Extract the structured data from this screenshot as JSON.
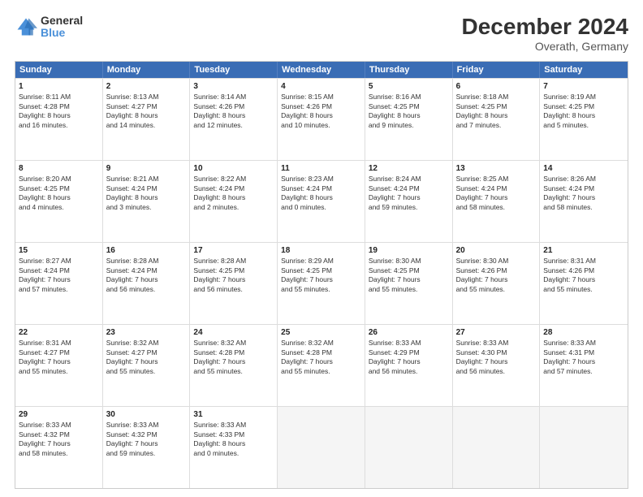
{
  "logo": {
    "line1": "General",
    "line2": "Blue"
  },
  "title": "December 2024",
  "subtitle": "Overath, Germany",
  "header_days": [
    "Sunday",
    "Monday",
    "Tuesday",
    "Wednesday",
    "Thursday",
    "Friday",
    "Saturday"
  ],
  "rows": [
    [
      {
        "day": "1",
        "lines": [
          "Sunrise: 8:11 AM",
          "Sunset: 4:28 PM",
          "Daylight: 8 hours",
          "and 16 minutes."
        ]
      },
      {
        "day": "2",
        "lines": [
          "Sunrise: 8:13 AM",
          "Sunset: 4:27 PM",
          "Daylight: 8 hours",
          "and 14 minutes."
        ]
      },
      {
        "day": "3",
        "lines": [
          "Sunrise: 8:14 AM",
          "Sunset: 4:26 PM",
          "Daylight: 8 hours",
          "and 12 minutes."
        ]
      },
      {
        "day": "4",
        "lines": [
          "Sunrise: 8:15 AM",
          "Sunset: 4:26 PM",
          "Daylight: 8 hours",
          "and 10 minutes."
        ]
      },
      {
        "day": "5",
        "lines": [
          "Sunrise: 8:16 AM",
          "Sunset: 4:25 PM",
          "Daylight: 8 hours",
          "and 9 minutes."
        ]
      },
      {
        "day": "6",
        "lines": [
          "Sunrise: 8:18 AM",
          "Sunset: 4:25 PM",
          "Daylight: 8 hours",
          "and 7 minutes."
        ]
      },
      {
        "day": "7",
        "lines": [
          "Sunrise: 8:19 AM",
          "Sunset: 4:25 PM",
          "Daylight: 8 hours",
          "and 5 minutes."
        ]
      }
    ],
    [
      {
        "day": "8",
        "lines": [
          "Sunrise: 8:20 AM",
          "Sunset: 4:25 PM",
          "Daylight: 8 hours",
          "and 4 minutes."
        ]
      },
      {
        "day": "9",
        "lines": [
          "Sunrise: 8:21 AM",
          "Sunset: 4:24 PM",
          "Daylight: 8 hours",
          "and 3 minutes."
        ]
      },
      {
        "day": "10",
        "lines": [
          "Sunrise: 8:22 AM",
          "Sunset: 4:24 PM",
          "Daylight: 8 hours",
          "and 2 minutes."
        ]
      },
      {
        "day": "11",
        "lines": [
          "Sunrise: 8:23 AM",
          "Sunset: 4:24 PM",
          "Daylight: 8 hours",
          "and 0 minutes."
        ]
      },
      {
        "day": "12",
        "lines": [
          "Sunrise: 8:24 AM",
          "Sunset: 4:24 PM",
          "Daylight: 7 hours",
          "and 59 minutes."
        ]
      },
      {
        "day": "13",
        "lines": [
          "Sunrise: 8:25 AM",
          "Sunset: 4:24 PM",
          "Daylight: 7 hours",
          "and 58 minutes."
        ]
      },
      {
        "day": "14",
        "lines": [
          "Sunrise: 8:26 AM",
          "Sunset: 4:24 PM",
          "Daylight: 7 hours",
          "and 58 minutes."
        ]
      }
    ],
    [
      {
        "day": "15",
        "lines": [
          "Sunrise: 8:27 AM",
          "Sunset: 4:24 PM",
          "Daylight: 7 hours",
          "and 57 minutes."
        ]
      },
      {
        "day": "16",
        "lines": [
          "Sunrise: 8:28 AM",
          "Sunset: 4:24 PM",
          "Daylight: 7 hours",
          "and 56 minutes."
        ]
      },
      {
        "day": "17",
        "lines": [
          "Sunrise: 8:28 AM",
          "Sunset: 4:25 PM",
          "Daylight: 7 hours",
          "and 56 minutes."
        ]
      },
      {
        "day": "18",
        "lines": [
          "Sunrise: 8:29 AM",
          "Sunset: 4:25 PM",
          "Daylight: 7 hours",
          "and 55 minutes."
        ]
      },
      {
        "day": "19",
        "lines": [
          "Sunrise: 8:30 AM",
          "Sunset: 4:25 PM",
          "Daylight: 7 hours",
          "and 55 minutes."
        ]
      },
      {
        "day": "20",
        "lines": [
          "Sunrise: 8:30 AM",
          "Sunset: 4:26 PM",
          "Daylight: 7 hours",
          "and 55 minutes."
        ]
      },
      {
        "day": "21",
        "lines": [
          "Sunrise: 8:31 AM",
          "Sunset: 4:26 PM",
          "Daylight: 7 hours",
          "and 55 minutes."
        ]
      }
    ],
    [
      {
        "day": "22",
        "lines": [
          "Sunrise: 8:31 AM",
          "Sunset: 4:27 PM",
          "Daylight: 7 hours",
          "and 55 minutes."
        ]
      },
      {
        "day": "23",
        "lines": [
          "Sunrise: 8:32 AM",
          "Sunset: 4:27 PM",
          "Daylight: 7 hours",
          "and 55 minutes."
        ]
      },
      {
        "day": "24",
        "lines": [
          "Sunrise: 8:32 AM",
          "Sunset: 4:28 PM",
          "Daylight: 7 hours",
          "and 55 minutes."
        ]
      },
      {
        "day": "25",
        "lines": [
          "Sunrise: 8:32 AM",
          "Sunset: 4:28 PM",
          "Daylight: 7 hours",
          "and 55 minutes."
        ]
      },
      {
        "day": "26",
        "lines": [
          "Sunrise: 8:33 AM",
          "Sunset: 4:29 PM",
          "Daylight: 7 hours",
          "and 56 minutes."
        ]
      },
      {
        "day": "27",
        "lines": [
          "Sunrise: 8:33 AM",
          "Sunset: 4:30 PM",
          "Daylight: 7 hours",
          "and 56 minutes."
        ]
      },
      {
        "day": "28",
        "lines": [
          "Sunrise: 8:33 AM",
          "Sunset: 4:31 PM",
          "Daylight: 7 hours",
          "and 57 minutes."
        ]
      }
    ],
    [
      {
        "day": "29",
        "lines": [
          "Sunrise: 8:33 AM",
          "Sunset: 4:32 PM",
          "Daylight: 7 hours",
          "and 58 minutes."
        ]
      },
      {
        "day": "30",
        "lines": [
          "Sunrise: 8:33 AM",
          "Sunset: 4:32 PM",
          "Daylight: 7 hours",
          "and 59 minutes."
        ]
      },
      {
        "day": "31",
        "lines": [
          "Sunrise: 8:33 AM",
          "Sunset: 4:33 PM",
          "Daylight: 8 hours",
          "and 0 minutes."
        ]
      },
      null,
      null,
      null,
      null
    ]
  ]
}
